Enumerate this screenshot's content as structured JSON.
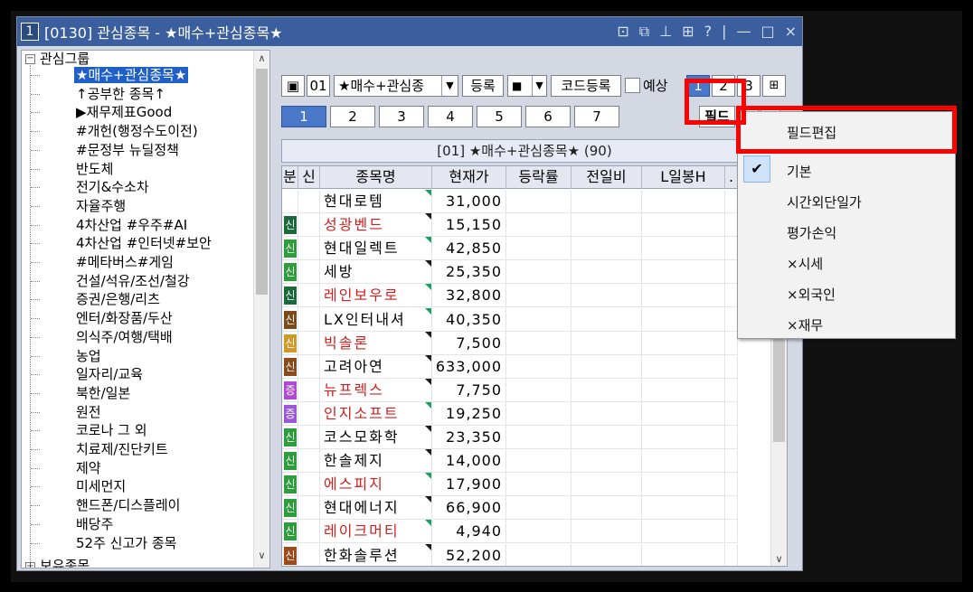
{
  "window": {
    "number": "1",
    "title": "[0130] 관심종목 - ★매수+관심종목★",
    "controls": [
      "⊡",
      "⧉",
      "⊥",
      "⊞",
      "?",
      "|",
      "—",
      "□",
      "×"
    ]
  },
  "tree": {
    "root": "관심그룹",
    "items": [
      {
        "label": "★매수+관심종목★",
        "selected": true
      },
      {
        "label": "↑공부한 종목↑"
      },
      {
        "label": "▶재무제표Good"
      },
      {
        "label": "#개헌(행정수도이전)"
      },
      {
        "label": "#문정부 뉴딜정책"
      },
      {
        "label": "반도체"
      },
      {
        "label": "전기&수소차"
      },
      {
        "label": "자율주행"
      },
      {
        "label": "4차산업 #우주#AI"
      },
      {
        "label": "4차산업 #인터넷#보안"
      },
      {
        "label": "#메타버스#게임"
      },
      {
        "label": "건설/석유/조선/철강"
      },
      {
        "label": "증권/은행/리츠"
      },
      {
        "label": "엔터/화장품/두산"
      },
      {
        "label": "의식주/여행/택배"
      },
      {
        "label": "농업"
      },
      {
        "label": "일자리/교육"
      },
      {
        "label": "북한/일본"
      },
      {
        "label": "원전"
      },
      {
        "label": "코로나 그 외"
      },
      {
        "label": "치료제/진단키트"
      },
      {
        "label": "제약"
      },
      {
        "label": "미세먼지"
      },
      {
        "label": "핸드폰/디스플레이"
      },
      {
        "label": "배당주"
      },
      {
        "label": "52주 신고가 종목"
      }
    ],
    "next_root": "보유종목"
  },
  "toolbar": {
    "group_no": "01",
    "group_name": "★매수+관심종",
    "register_label": "등록",
    "square_label": "■",
    "code_register_label": "코드등록",
    "forecast_label": "예상",
    "page_tabs": [
      "1",
      "2",
      "3"
    ],
    "sub_tabs": [
      "1",
      "2",
      "3",
      "4",
      "5",
      "6",
      "7"
    ],
    "field_label": "필드"
  },
  "group_header": "[01] ★매수+관심종목★ (90)",
  "columns": [
    "분",
    "신",
    "종목명",
    "현재가",
    "등락률",
    "전일비",
    "L일봉H",
    "."
  ],
  "rows": [
    {
      "mark": "",
      "name": "현대로템",
      "price": "31,000",
      "red": false,
      "tri": "green"
    },
    {
      "mark": "신",
      "mark_color": "#1a6b3a",
      "name": "성광벤드",
      "price": "15,150",
      "red": true,
      "tri": "black"
    },
    {
      "mark": "신",
      "mark_color": "#2e9e3c",
      "name": "현대일렉트",
      "price": "42,850",
      "red": false,
      "tri": "green"
    },
    {
      "mark": "신",
      "mark_color": "#2e9e3c",
      "name": "세방",
      "price": "25,350",
      "red": false,
      "tri": "black"
    },
    {
      "mark": "신",
      "mark_color": "#1a6b3a",
      "name": "레인보우로",
      "price": "32,800",
      "red": true,
      "tri": "green"
    },
    {
      "mark": "신",
      "mark_color": "#7a4a1a",
      "name": "LX인터내셔",
      "price": "40,350",
      "red": false,
      "tri": "green"
    },
    {
      "mark": "신",
      "mark_color": "#d09a2a",
      "name": "빅솔론",
      "price": "7,500",
      "red": true,
      "tri": "black"
    },
    {
      "mark": "신",
      "mark_color": "#8a4a1a",
      "name": "고려아연",
      "price": "633,000",
      "red": false,
      "tri": "black"
    },
    {
      "mark": "증",
      "mark_color": "#b04ad0",
      "name": "뉴프렉스",
      "price": "7,750",
      "red": true,
      "tri": "black"
    },
    {
      "mark": "증",
      "mark_color": "#9a5ad8",
      "name": "인지소프트",
      "price": "19,250",
      "red": true,
      "tri": "green"
    },
    {
      "mark": "신",
      "mark_color": "#2e9e3c",
      "name": "코스모화학",
      "price": "23,350",
      "red": false,
      "tri": "black"
    },
    {
      "mark": "신",
      "mark_color": "#2e9e3c",
      "name": "한솔제지",
      "price": "14,000",
      "red": false,
      "tri": "black"
    },
    {
      "mark": "신",
      "mark_color": "#2e9e3c",
      "name": "에스피지",
      "price": "17,900",
      "red": true,
      "tri": "green"
    },
    {
      "mark": "신",
      "mark_color": "#2e9e3c",
      "name": "현대에너지",
      "price": "66,900",
      "red": false,
      "tri": "black"
    },
    {
      "mark": "신",
      "mark_color": "#2e9e3c",
      "name": "레이크머티",
      "price": "4,940",
      "red": true,
      "tri": "green"
    },
    {
      "mark": "신",
      "mark_color": "#a04a1a",
      "name": "한화솔루션",
      "price": "52,200",
      "red": false,
      "tri": "black"
    }
  ],
  "menu": {
    "items": [
      "필드편집",
      "기본",
      "시간외단일가",
      "평가손익",
      "×시세",
      "×외국인",
      "×재무"
    ],
    "checked_index": 1
  },
  "colors": {
    "title_bar": "#3a5e9e",
    "selection": "#1f5fc8",
    "highlight": "#ff0000",
    "red_text": "#d02020"
  }
}
